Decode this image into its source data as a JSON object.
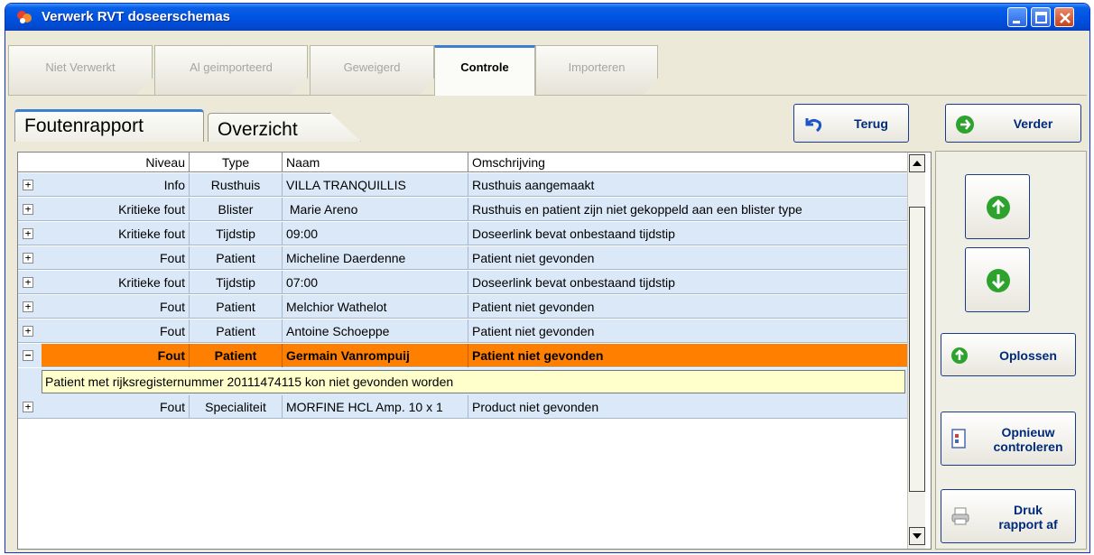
{
  "window": {
    "title": "Verwerk RVT doseerschemas"
  },
  "top_tabs": [
    {
      "label": "Niet Verwerkt"
    },
    {
      "label": "Al geimporteerd"
    },
    {
      "label": "Geweigerd"
    },
    {
      "label": "Controle"
    },
    {
      "label": "Importeren"
    }
  ],
  "sub_tabs": [
    {
      "label": "Foutenrapport"
    },
    {
      "label": "Overzicht"
    }
  ],
  "buttons": {
    "terug": "Terug",
    "verder": "Verder",
    "oplossen": "Oplossen",
    "opnieuw_1": "Opnieuw",
    "opnieuw_2": "controleren",
    "druk_1": "Druk",
    "druk_2": "rapport af"
  },
  "grid": {
    "columns": [
      "Niveau",
      "Type",
      "Naam",
      "Omschrijving"
    ],
    "rows": [
      [
        "Info",
        "Rusthuis",
        "VILLA TRANQUILLIS",
        "Rusthuis aangemaakt"
      ],
      [
        "Kritieke fout",
        "Blister",
        " Marie Areno",
        "Rusthuis en patient zijn niet gekoppeld aan een blister type"
      ],
      [
        "Kritieke fout",
        "Tijdstip",
        "09:00",
        "Doseerlink bevat onbestaand tijdstip"
      ],
      [
        "Fout",
        "Patient",
        "Micheline Daerdenne",
        "Patient niet gevonden"
      ],
      [
        "Kritieke fout",
        "Tijdstip",
        "07:00",
        "Doseerlink bevat onbestaand tijdstip"
      ],
      [
        "Fout",
        "Patient",
        "Melchior Wathelot",
        "Patient niet gevonden"
      ],
      [
        "Fout",
        "Patient",
        "Antoine Schoeppe",
        "Patient niet gevonden"
      ],
      [
        "Fout",
        "Patient",
        "Germain Vanrompuij",
        "Patient niet gevonden"
      ]
    ],
    "detail": "Patient met rijksregisternummer 20111474115 kon niet gevonden worden",
    "last_row": [
      "Fout",
      "Specialiteit",
      "MORFINE HCL Amp. 10 x 1",
      "Product niet gevonden"
    ],
    "expand_symbol": "+",
    "collapse_symbol": "−"
  },
  "colors": {
    "selected_row": "#ff7f00",
    "row_bg": "#dae8f7",
    "detail_bg": "#ffffcc",
    "title_bar": "#0054e3"
  }
}
